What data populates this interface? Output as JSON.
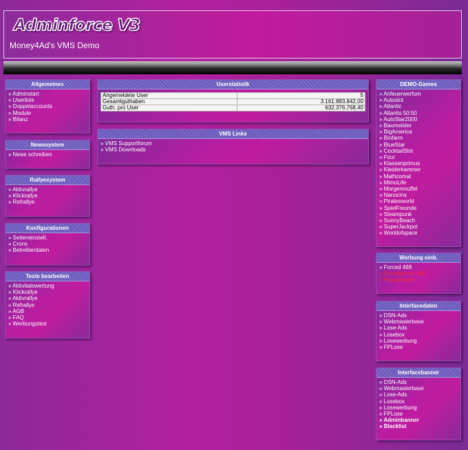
{
  "header": {
    "logo": "Adminforce V3",
    "subtitle": "Money4Ad's VMS Demo"
  },
  "left": [
    {
      "title": "Allgemeines",
      "items": [
        "Adminstart",
        "Userliste",
        "Doppelaccounts",
        "Module",
        "Bilanz"
      ]
    },
    {
      "title": "Newssystem",
      "items": [
        "News schreiben"
      ]
    },
    {
      "title": "Rallyesystem",
      "items": [
        "Aktivrallye",
        "Klickrallye",
        "Refrallye"
      ]
    },
    {
      "title": "Konfigurationen",
      "items": [
        "Seiteneinstell.",
        "Crons",
        "Betreiberdaten"
      ]
    },
    {
      "title": "Texte bearbeiten",
      "items": [
        "Aktivitatswertung",
        "Klickrallye",
        "Aktivrallye",
        "Refrallye",
        "AGB",
        "FAQ",
        "Werbungstext"
      ]
    }
  ],
  "center": {
    "stats": {
      "title": "Userstatistik",
      "rows": [
        {
          "label": "Angemeldete User",
          "value": "5"
        },
        {
          "label": "Gesamtguthaben",
          "value": "3.161.883.842,00"
        },
        {
          "label": "Guth. pro User",
          "value": "632.376.768,40"
        }
      ]
    },
    "vms": {
      "title": "VMS Links",
      "items": [
        "VMS Supportforum",
        "VMS Downloads"
      ]
    }
  },
  "right": [
    {
      "title": "DEMO-Games",
      "items": [
        "Anfeuerwerfum",
        "Autoslot",
        "Atlantic",
        "Atlantis 50:50",
        "AutoStar2000",
        "Baumeister",
        "BigAmerica",
        "Biofarm",
        "BlueStar",
        "CocktailSlot",
        "Four",
        "Klassenprimus",
        "Kleiderkammer",
        "Mathcomat",
        "MimoLife",
        "Morgenmuffel",
        "Nanocins",
        "Piratesworld",
        "SpielFreunde",
        "Steampunk",
        "SunnyBeach",
        "SuperJackpot",
        "Worldofspace"
      ]
    },
    {
      "title": "Werbung einb.",
      "items": [
        {
          "text": "Forced 468",
          "color": "normal"
        },
        {
          "text": "Forcebanner 468",
          "color": "red"
        },
        {
          "text": "Popup/Layer",
          "color": "red"
        }
      ]
    },
    {
      "title": "Interfacedaten",
      "items": [
        "DSN-Ads",
        "Webmasterbase",
        "Lose-Ads",
        "Losebox",
        "Losewerbung",
        "FPLose"
      ]
    },
    {
      "title": "Interfacebanner",
      "items": [
        {
          "text": "DSN-Ads",
          "bold": false
        },
        {
          "text": "Webmasterbase",
          "bold": false
        },
        {
          "text": "Lose-Ads",
          "bold": false
        },
        {
          "text": "Losebox",
          "bold": false
        },
        {
          "text": "Losewerbung",
          "bold": false
        },
        {
          "text": "FPLose",
          "bold": false
        },
        {
          "text": "Adminbanner",
          "bold": true
        },
        {
          "text": "Blacklist",
          "bold": true
        }
      ]
    }
  ]
}
